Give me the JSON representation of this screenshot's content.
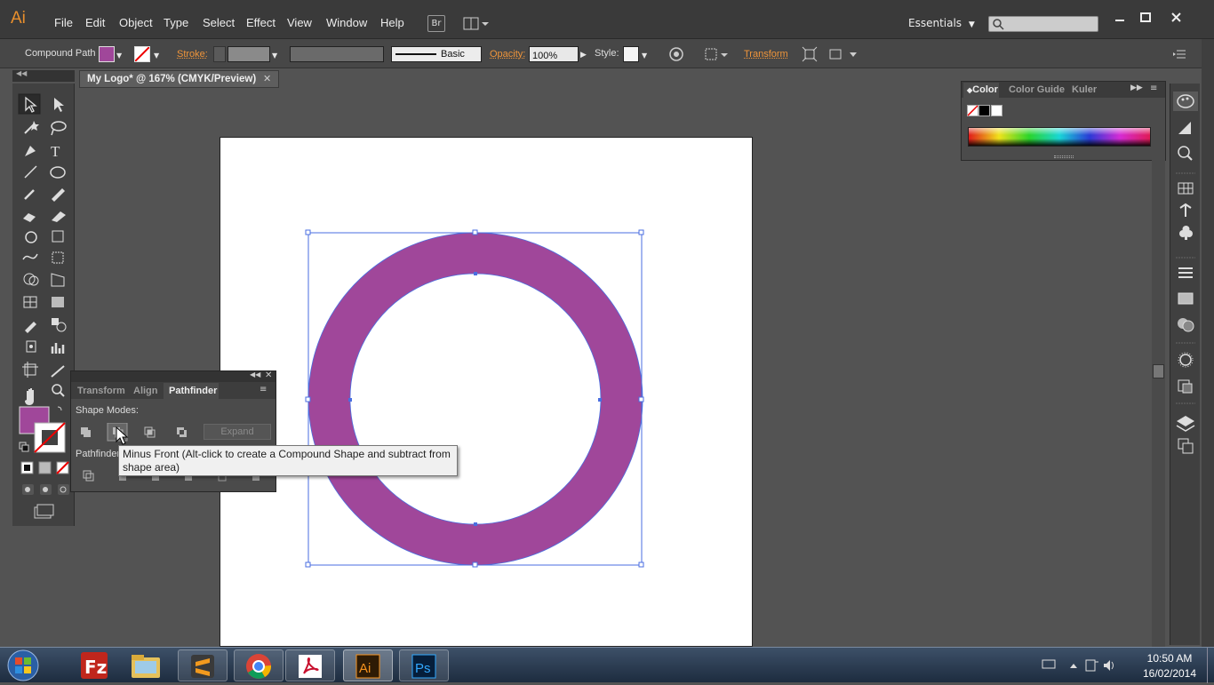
{
  "app": {
    "logo": "Ai",
    "bridge_label": "Br"
  },
  "menu": [
    "File",
    "Edit",
    "Object",
    "Type",
    "Select",
    "Effect",
    "View",
    "Window",
    "Help"
  ],
  "workspace": {
    "label": "Essentials",
    "search_placeholder": ""
  },
  "control_bar": {
    "selection_type": "Compound Path",
    "fill_color": "#a0479a",
    "stroke_label": "Stroke:",
    "brush_label": "Basic",
    "opacity_label": "Opacity:",
    "opacity_value": "100%",
    "style_label": "Style:",
    "transform_label": "Transform"
  },
  "document": {
    "tab_title": "My Logo* @ 167% (CMYK/Preview)",
    "shape_color": "#a0479a",
    "accent": "#4a6ee0"
  },
  "color_panel": {
    "tabs": [
      "Color",
      "Color Guide",
      "Kuler"
    ]
  },
  "pathfinder_panel": {
    "tabs": [
      "Transform",
      "Align",
      "Pathfinder"
    ],
    "shape_modes_label": "Shape Modes:",
    "expand_label": "Expand",
    "pathfinders_label": "Pathfinder"
  },
  "tooltip": {
    "text": "Minus Front (Alt-click to create a Compound Shape and subtract from shape area)"
  },
  "taskbar": {
    "icons": [
      "start-orb",
      "filezilla",
      "file-explorer",
      "sublime-text",
      "chrome",
      "acrobat",
      "illustrator",
      "photoshop"
    ],
    "time": "10:50 AM",
    "date": "16/02/2014"
  }
}
